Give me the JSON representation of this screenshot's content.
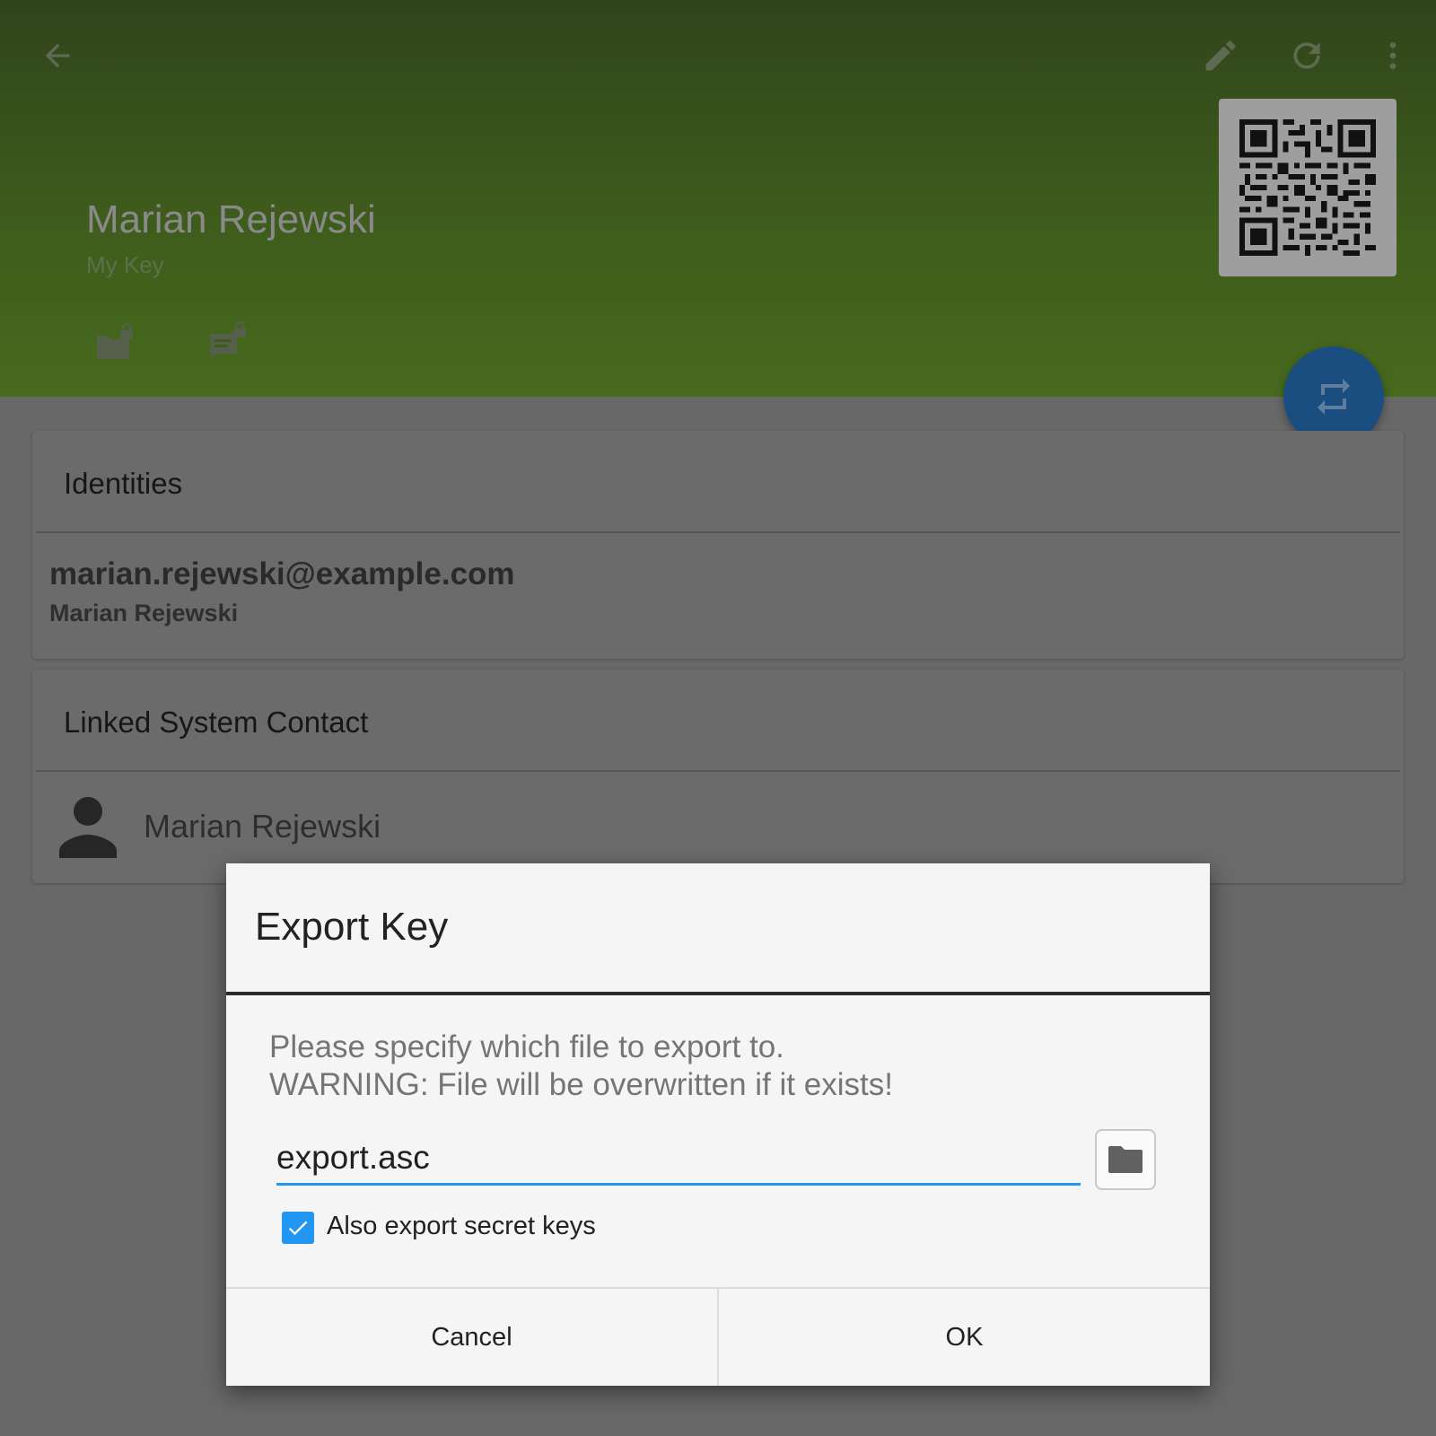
{
  "header": {
    "key_name": "Marian Rejewski",
    "key_subtitle": "My Key",
    "background_color": "#476a1d",
    "icons": [
      "arrow-back-icon",
      "edit-icon",
      "refresh-icon",
      "more-vert-icon",
      "qr-code-icon",
      "encrypt-files-icon",
      "encrypt-text-icon",
      "exchange-icon"
    ]
  },
  "identities": {
    "title": "Identities",
    "email": "marian.rejewski@example.com",
    "name": "Marian Rejewski"
  },
  "linked_contact": {
    "title": "Linked System Contact",
    "name": "Marian Rejewski"
  },
  "dialog": {
    "title": "Export Key",
    "message_line1": "Please specify which file to export to.",
    "message_line2": "WARNING: File will be overwritten if it exists!",
    "filename": "export.asc",
    "checkbox_label": "Also export secret keys",
    "checkbox_checked": true,
    "cancel_label": "Cancel",
    "ok_label": "OK",
    "accent_color": "#2196f3"
  }
}
